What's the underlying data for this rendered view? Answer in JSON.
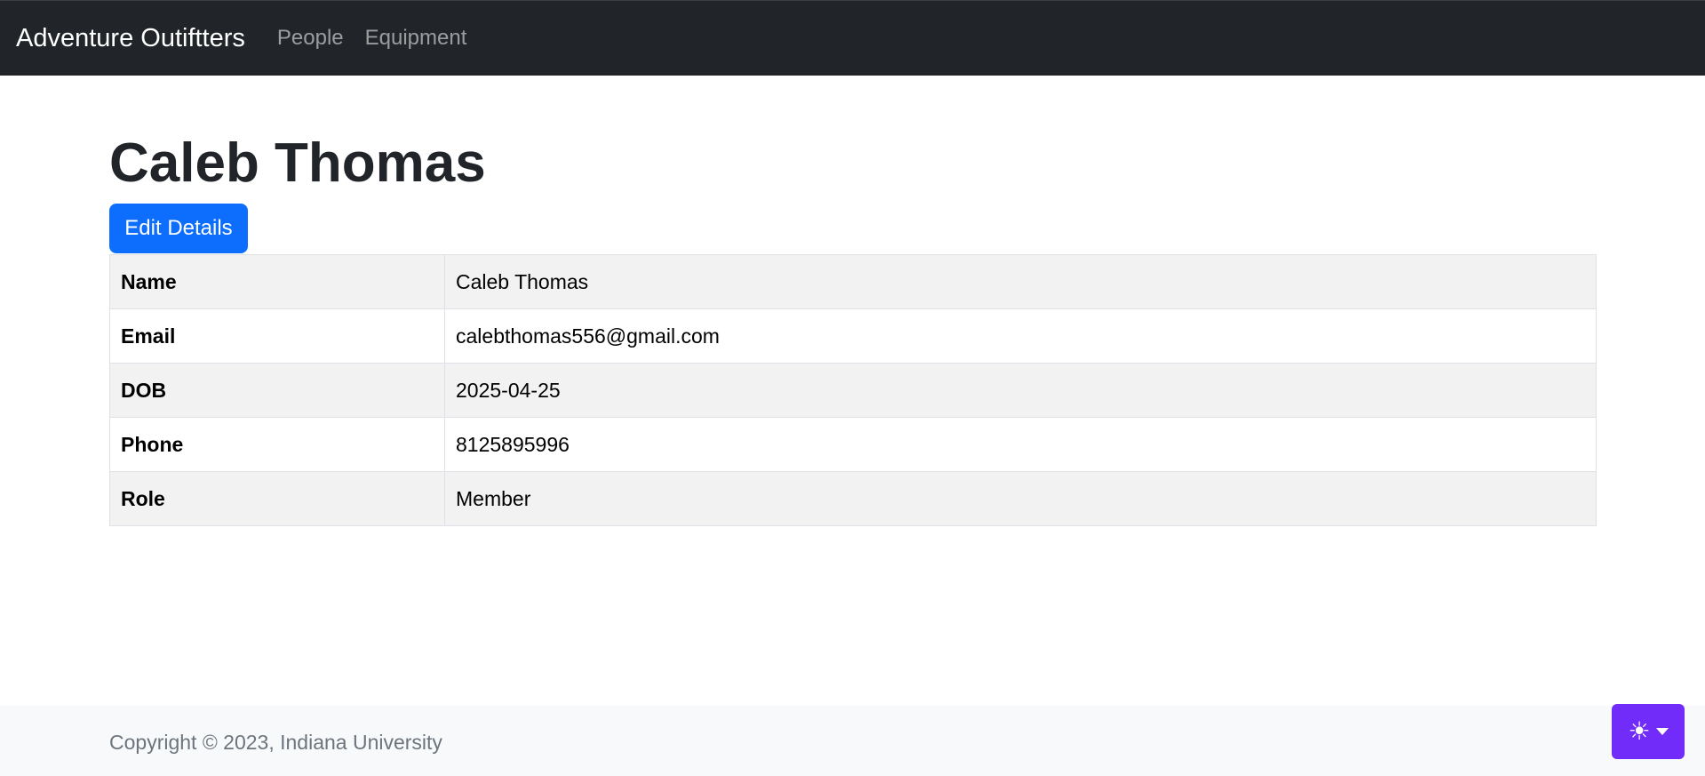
{
  "navbar": {
    "brand": "Adventure Outiftters",
    "links": [
      "People",
      "Equipment"
    ]
  },
  "page": {
    "title": "Caleb Thomas",
    "edit_button": "Edit Details"
  },
  "details": [
    {
      "label": "Name",
      "value": "Caleb Thomas"
    },
    {
      "label": "Email",
      "value": "calebthomas556@gmail.com"
    },
    {
      "label": "DOB",
      "value": "2025-04-25"
    },
    {
      "label": "Phone",
      "value": "8125895996"
    },
    {
      "label": "Role",
      "value": "Member"
    }
  ],
  "footer": {
    "copyright": "Copyright © 2023, Indiana University"
  },
  "theme_toggle": {
    "icon": "sun-icon",
    "color": "#712cf9"
  },
  "colors": {
    "navbar": "#212529",
    "primary": "#0d6efd",
    "stripe": "#f2f2f2"
  }
}
